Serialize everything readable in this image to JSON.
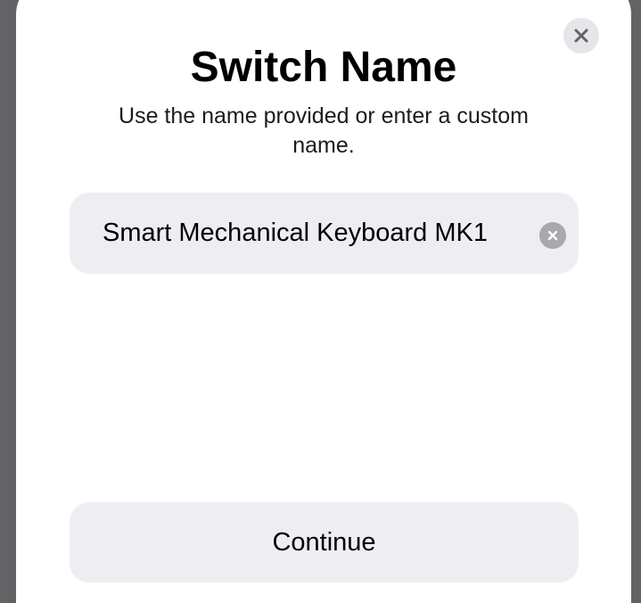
{
  "sheet": {
    "title": "Switch Name",
    "subtitle": "Use the name provided or enter a custom name.",
    "close_icon": "close-icon"
  },
  "name_field": {
    "value": "Smart Mechanical Keyboard MK1",
    "clear_icon": "clear-icon"
  },
  "actions": {
    "continue_label": "Continue"
  },
  "colors": {
    "background_dim": "#636366",
    "sheet_bg": "#ffffff",
    "field_bg": "#eeeef2",
    "close_bg": "#e5e5ea",
    "clear_bg": "#a8a8ad",
    "text": "#000000"
  }
}
